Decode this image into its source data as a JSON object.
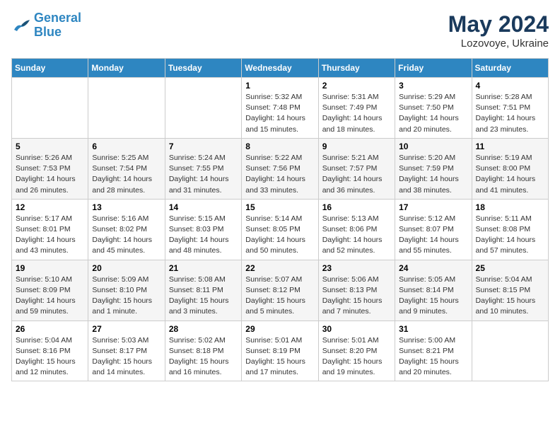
{
  "header": {
    "logo_line1": "General",
    "logo_line2": "Blue",
    "month": "May 2024",
    "location": "Lozovoye, Ukraine"
  },
  "weekdays": [
    "Sunday",
    "Monday",
    "Tuesday",
    "Wednesday",
    "Thursday",
    "Friday",
    "Saturday"
  ],
  "weeks": [
    [
      {
        "day": "",
        "info": ""
      },
      {
        "day": "",
        "info": ""
      },
      {
        "day": "",
        "info": ""
      },
      {
        "day": "1",
        "info": "Sunrise: 5:32 AM\nSunset: 7:48 PM\nDaylight: 14 hours\nand 15 minutes."
      },
      {
        "day": "2",
        "info": "Sunrise: 5:31 AM\nSunset: 7:49 PM\nDaylight: 14 hours\nand 18 minutes."
      },
      {
        "day": "3",
        "info": "Sunrise: 5:29 AM\nSunset: 7:50 PM\nDaylight: 14 hours\nand 20 minutes."
      },
      {
        "day": "4",
        "info": "Sunrise: 5:28 AM\nSunset: 7:51 PM\nDaylight: 14 hours\nand 23 minutes."
      }
    ],
    [
      {
        "day": "5",
        "info": "Sunrise: 5:26 AM\nSunset: 7:53 PM\nDaylight: 14 hours\nand 26 minutes."
      },
      {
        "day": "6",
        "info": "Sunrise: 5:25 AM\nSunset: 7:54 PM\nDaylight: 14 hours\nand 28 minutes."
      },
      {
        "day": "7",
        "info": "Sunrise: 5:24 AM\nSunset: 7:55 PM\nDaylight: 14 hours\nand 31 minutes."
      },
      {
        "day": "8",
        "info": "Sunrise: 5:22 AM\nSunset: 7:56 PM\nDaylight: 14 hours\nand 33 minutes."
      },
      {
        "day": "9",
        "info": "Sunrise: 5:21 AM\nSunset: 7:57 PM\nDaylight: 14 hours\nand 36 minutes."
      },
      {
        "day": "10",
        "info": "Sunrise: 5:20 AM\nSunset: 7:59 PM\nDaylight: 14 hours\nand 38 minutes."
      },
      {
        "day": "11",
        "info": "Sunrise: 5:19 AM\nSunset: 8:00 PM\nDaylight: 14 hours\nand 41 minutes."
      }
    ],
    [
      {
        "day": "12",
        "info": "Sunrise: 5:17 AM\nSunset: 8:01 PM\nDaylight: 14 hours\nand 43 minutes."
      },
      {
        "day": "13",
        "info": "Sunrise: 5:16 AM\nSunset: 8:02 PM\nDaylight: 14 hours\nand 45 minutes."
      },
      {
        "day": "14",
        "info": "Sunrise: 5:15 AM\nSunset: 8:03 PM\nDaylight: 14 hours\nand 48 minutes."
      },
      {
        "day": "15",
        "info": "Sunrise: 5:14 AM\nSunset: 8:05 PM\nDaylight: 14 hours\nand 50 minutes."
      },
      {
        "day": "16",
        "info": "Sunrise: 5:13 AM\nSunset: 8:06 PM\nDaylight: 14 hours\nand 52 minutes."
      },
      {
        "day": "17",
        "info": "Sunrise: 5:12 AM\nSunset: 8:07 PM\nDaylight: 14 hours\nand 55 minutes."
      },
      {
        "day": "18",
        "info": "Sunrise: 5:11 AM\nSunset: 8:08 PM\nDaylight: 14 hours\nand 57 minutes."
      }
    ],
    [
      {
        "day": "19",
        "info": "Sunrise: 5:10 AM\nSunset: 8:09 PM\nDaylight: 14 hours\nand 59 minutes."
      },
      {
        "day": "20",
        "info": "Sunrise: 5:09 AM\nSunset: 8:10 PM\nDaylight: 15 hours\nand 1 minute."
      },
      {
        "day": "21",
        "info": "Sunrise: 5:08 AM\nSunset: 8:11 PM\nDaylight: 15 hours\nand 3 minutes."
      },
      {
        "day": "22",
        "info": "Sunrise: 5:07 AM\nSunset: 8:12 PM\nDaylight: 15 hours\nand 5 minutes."
      },
      {
        "day": "23",
        "info": "Sunrise: 5:06 AM\nSunset: 8:13 PM\nDaylight: 15 hours\nand 7 minutes."
      },
      {
        "day": "24",
        "info": "Sunrise: 5:05 AM\nSunset: 8:14 PM\nDaylight: 15 hours\nand 9 minutes."
      },
      {
        "day": "25",
        "info": "Sunrise: 5:04 AM\nSunset: 8:15 PM\nDaylight: 15 hours\nand 10 minutes."
      }
    ],
    [
      {
        "day": "26",
        "info": "Sunrise: 5:04 AM\nSunset: 8:16 PM\nDaylight: 15 hours\nand 12 minutes."
      },
      {
        "day": "27",
        "info": "Sunrise: 5:03 AM\nSunset: 8:17 PM\nDaylight: 15 hours\nand 14 minutes."
      },
      {
        "day": "28",
        "info": "Sunrise: 5:02 AM\nSunset: 8:18 PM\nDaylight: 15 hours\nand 16 minutes."
      },
      {
        "day": "29",
        "info": "Sunrise: 5:01 AM\nSunset: 8:19 PM\nDaylight: 15 hours\nand 17 minutes."
      },
      {
        "day": "30",
        "info": "Sunrise: 5:01 AM\nSunset: 8:20 PM\nDaylight: 15 hours\nand 19 minutes."
      },
      {
        "day": "31",
        "info": "Sunrise: 5:00 AM\nSunset: 8:21 PM\nDaylight: 15 hours\nand 20 minutes."
      },
      {
        "day": "",
        "info": ""
      }
    ]
  ]
}
